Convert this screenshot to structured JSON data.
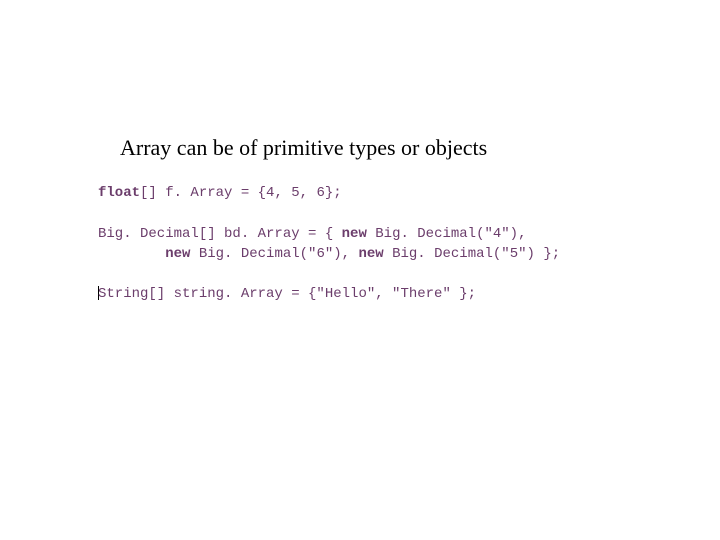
{
  "title": "Array can be of primitive types or objects",
  "code": {
    "l1_kw": "float",
    "l1_rest": "[] f. Array = {4, 5, 6};",
    "l2_type": "Big. Decimal[] bd. Array = { ",
    "l2_new1": "new",
    "l2_call1": " Big. Decimal(\"4\"),",
    "l3_indent": "        ",
    "l3_new1": "new",
    "l3_call1": " Big. Decimal(\"6\"), ",
    "l3_new2": "new",
    "l3_call2": " Big. Decimal(\"5\") };",
    "l5_a": "String[] string. Array = {\"Hello\", \"There\" };"
  }
}
